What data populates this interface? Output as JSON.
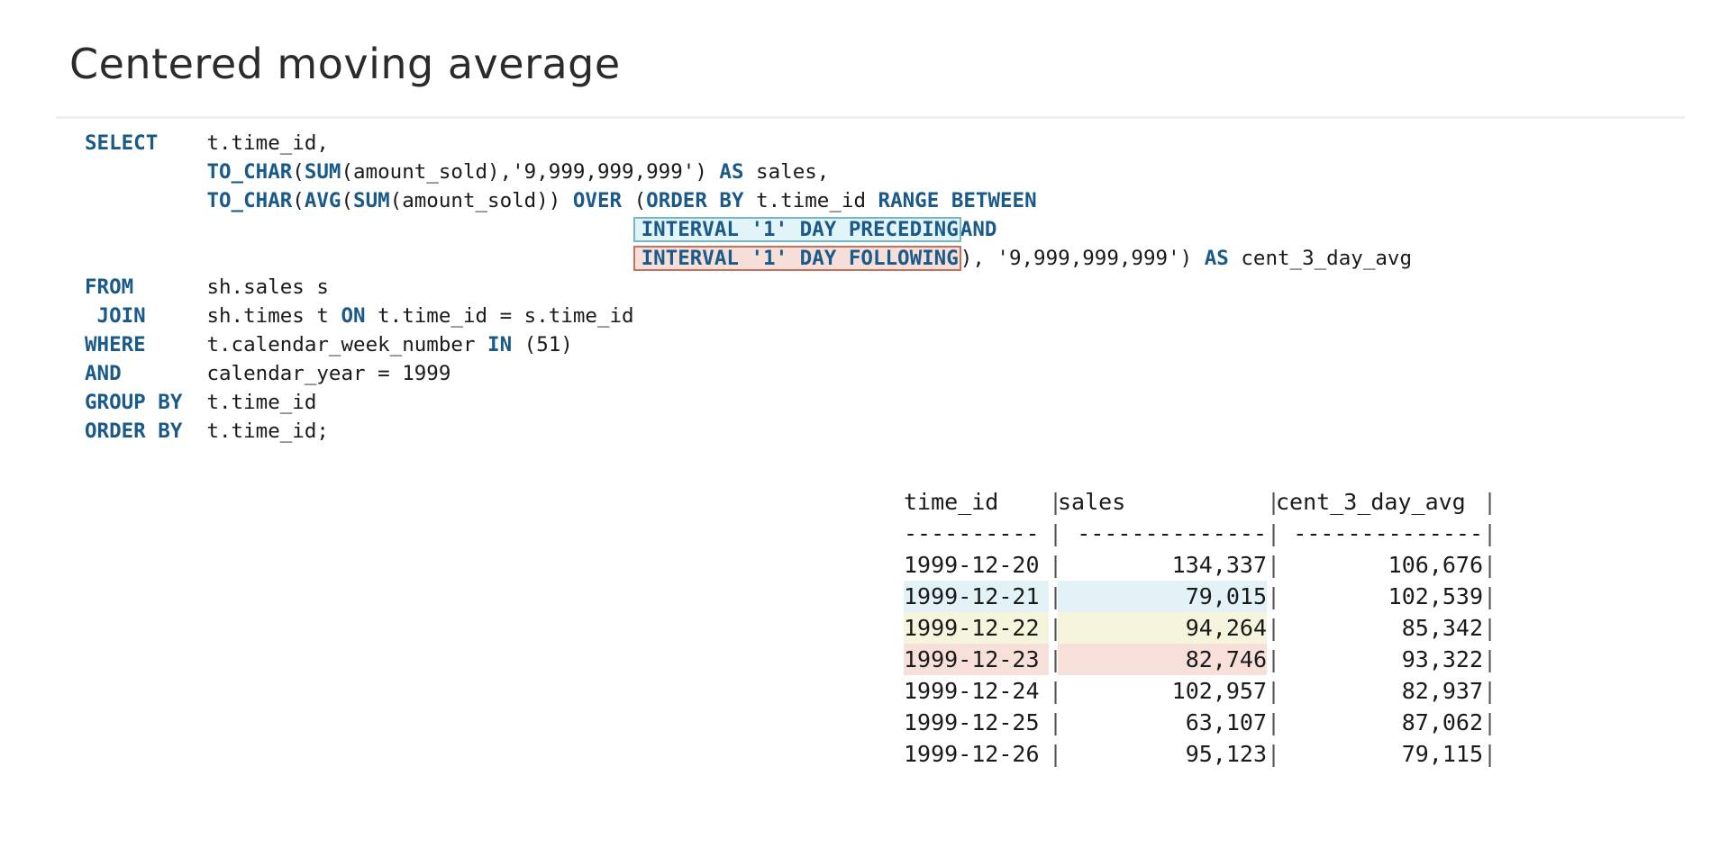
{
  "page": {
    "title": "Centered moving average"
  },
  "sql": {
    "select_kw": "SELECT",
    "select_col1": "t.time_id,",
    "to_char1": "TO_CHAR",
    "sum1": "SUM",
    "sum1_args": "(amount_sold),'9,999,999,999') ",
    "as1": "AS",
    "sales_alias": " sales,",
    "to_char2": "TO_CHAR",
    "avg": "AVG",
    "sum2": "SUM",
    "sum2_args": "(amount_sold)) ",
    "over": "OVER",
    "paren_open": " (",
    "order_by_inner": "ORDER BY",
    "time_id_inner": " t.time_id ",
    "range_between": "RANGE BETWEEN",
    "interval_preceding": "INTERVAL '1' DAY PRECEDING",
    "and_inner": "AND",
    "interval_following": "INTERVAL '1' DAY FOLLOWING",
    "following_tail": "), '9,999,999,999') ",
    "as2": "AS",
    "avg_alias": " cent_3_day_avg",
    "from_kw": "FROM",
    "from_val": "sh.sales s",
    "join_kw": "JOIN",
    "join_val1": "sh.times t ",
    "on_kw": "ON",
    "join_val2": " t.time_id = s.time_id",
    "where_kw": "WHERE",
    "where_val1": "t.calendar_week_number ",
    "in_kw": "IN",
    "where_val2": " (51)",
    "and_kw": "AND",
    "and_val": "calendar_year = 1999",
    "group_kw": "GROUP BY",
    "group_val": "t.time_id",
    "order_kw": "ORDER BY",
    "order_val": "t.time_id;"
  },
  "result": {
    "headers": [
      "time_id",
      "sales",
      "cent_3_day_avg"
    ],
    "separator": [
      "----------",
      "--------------",
      "--------------"
    ],
    "rows": [
      {
        "time_id": "1999-12-20",
        "sales": "134,337",
        "avg": "106,676",
        "highlight": "none"
      },
      {
        "time_id": "1999-12-21",
        "sales": "79,015",
        "avg": "102,539",
        "highlight": "blue"
      },
      {
        "time_id": "1999-12-22",
        "sales": "94,264",
        "avg": "85,342",
        "highlight": "yellow"
      },
      {
        "time_id": "1999-12-23",
        "sales": "82,746",
        "avg": "93,322",
        "highlight": "red"
      },
      {
        "time_id": "1999-12-24",
        "sales": "102,957",
        "avg": "82,937",
        "highlight": "none"
      },
      {
        "time_id": "1999-12-25",
        "sales": "63,107",
        "avg": "87,062",
        "highlight": "none"
      },
      {
        "time_id": "1999-12-26",
        "sales": "95,123",
        "avg": "79,115",
        "highlight": "none"
      }
    ],
    "bar": "|"
  },
  "colors": {
    "keyword": "#1a5a8a",
    "highlight_blue": "#e2f4f7",
    "highlight_yellow": "#f5f4dc",
    "highlight_red": "#f7dfd9"
  }
}
